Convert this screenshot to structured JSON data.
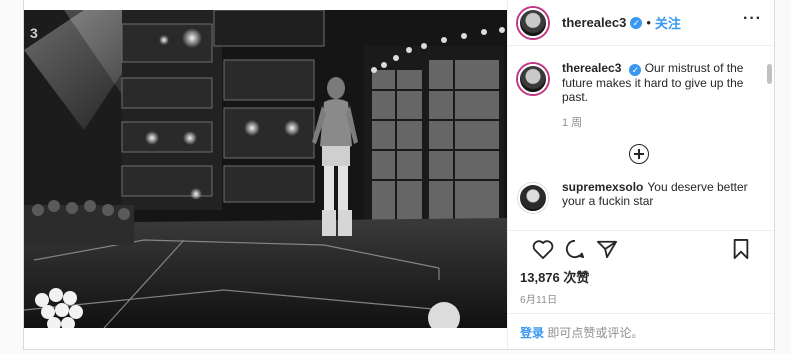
{
  "post": {
    "author": "therealec3",
    "follow_label": "关注",
    "separator": "•",
    "more_icon": "more-options-icon",
    "caption": "Our mistrust of the future makes it hard to give up the past.",
    "caption_time": "1 周",
    "likes": "13,876 次赞",
    "date": "6月11日",
    "login_link": "登录",
    "login_suffix": " 即可点赞或评论。"
  },
  "comments": [
    {
      "user": "supremexsolo",
      "text": "You deserve better your a fuckin star"
    }
  ],
  "icons": {
    "like": "heart-icon",
    "comment": "comment-bubble-icon",
    "share": "share-icon",
    "save": "bookmark-icon",
    "load_more": "plus-circle-icon",
    "verified": "verified-badge-icon"
  },
  "colors": {
    "link_blue": "#3897f0",
    "text": "#262626",
    "muted": "#8e8e8e"
  },
  "photo": {
    "stage_logo": "3"
  }
}
